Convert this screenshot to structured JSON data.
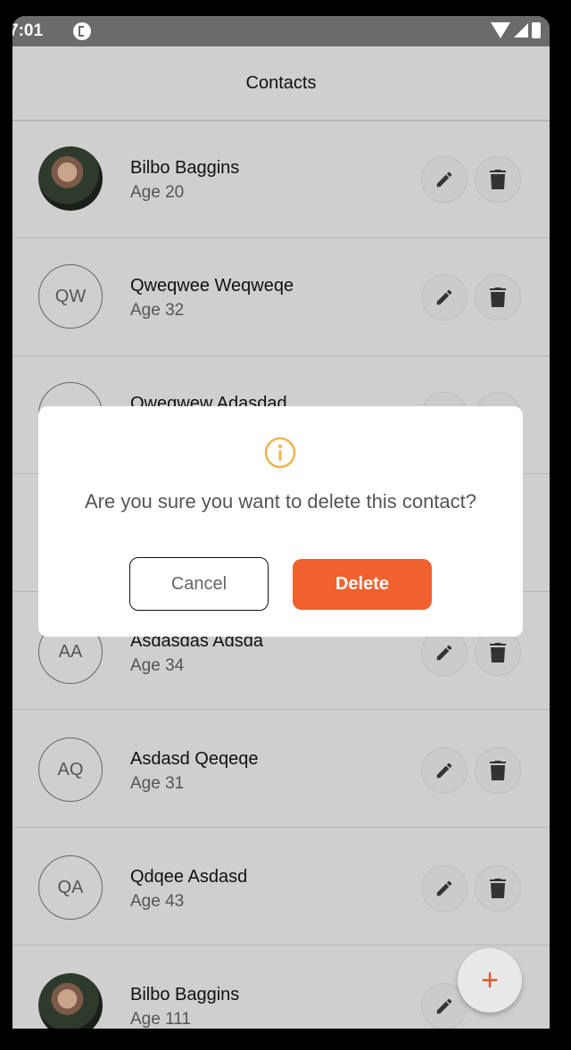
{
  "status_bar": {
    "time": "7:01"
  },
  "app_bar": {
    "title": "Contacts"
  },
  "contacts": [
    {
      "name": "Bilbo Baggins",
      "age": "Age 20",
      "initials": "",
      "has_photo": true
    },
    {
      "name": "Qweqwee Weqweqe",
      "age": "Age 32",
      "initials": "QW",
      "has_photo": false
    },
    {
      "name": "Qweqwew Adasdad",
      "age": "",
      "initials": "",
      "has_photo": false
    },
    {
      "name": "Asdasdas Adsda",
      "age": "Age 34",
      "initials": "AA",
      "has_photo": false
    },
    {
      "name": "Asdasd Qeqeqe",
      "age": "Age 31",
      "initials": "AQ",
      "has_photo": false
    },
    {
      "name": "Qdqee Asdasd",
      "age": "Age 43",
      "initials": "QA",
      "has_photo": false
    },
    {
      "name": "Bilbo Baggins",
      "age": "Age 111",
      "initials": "",
      "has_photo": true
    }
  ],
  "dialog": {
    "message": "Are you sure you want to delete this contact?",
    "cancel_label": "Cancel",
    "delete_label": "Delete"
  },
  "fab": {
    "label": "+"
  },
  "colors": {
    "accent": "#f1612f",
    "fab_plus": "#e4572e",
    "info": "#f0b54a"
  }
}
